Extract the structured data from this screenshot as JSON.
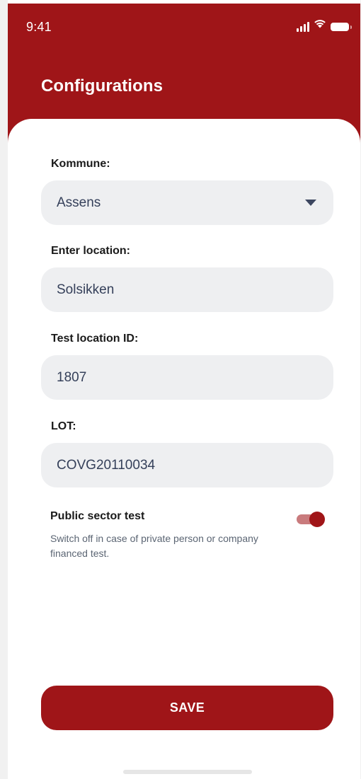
{
  "status_bar": {
    "time": "9:41",
    "icons": [
      "signal-icon",
      "wifi-icon",
      "battery-icon"
    ]
  },
  "header": {
    "title": "Configurations"
  },
  "form": {
    "kommune": {
      "label": "Kommune:",
      "value": "Assens",
      "icon": "chevron-down-icon"
    },
    "location": {
      "label": "Enter location:",
      "value": "Solsikken"
    },
    "test_location_id": {
      "label": "Test location ID:",
      "value": "1807"
    },
    "lot": {
      "label": "LOT:",
      "value": "COVG20110034"
    },
    "public_sector_test": {
      "title": "Public sector test",
      "description": "Switch off in case of private person or company financed test.",
      "enabled": true
    }
  },
  "actions": {
    "save_label": "SAVE"
  },
  "colors": {
    "brand": "#9f1518",
    "field_bg": "#eeeff1",
    "text_dark": "#1a1a1a",
    "text_field": "#35405a"
  }
}
